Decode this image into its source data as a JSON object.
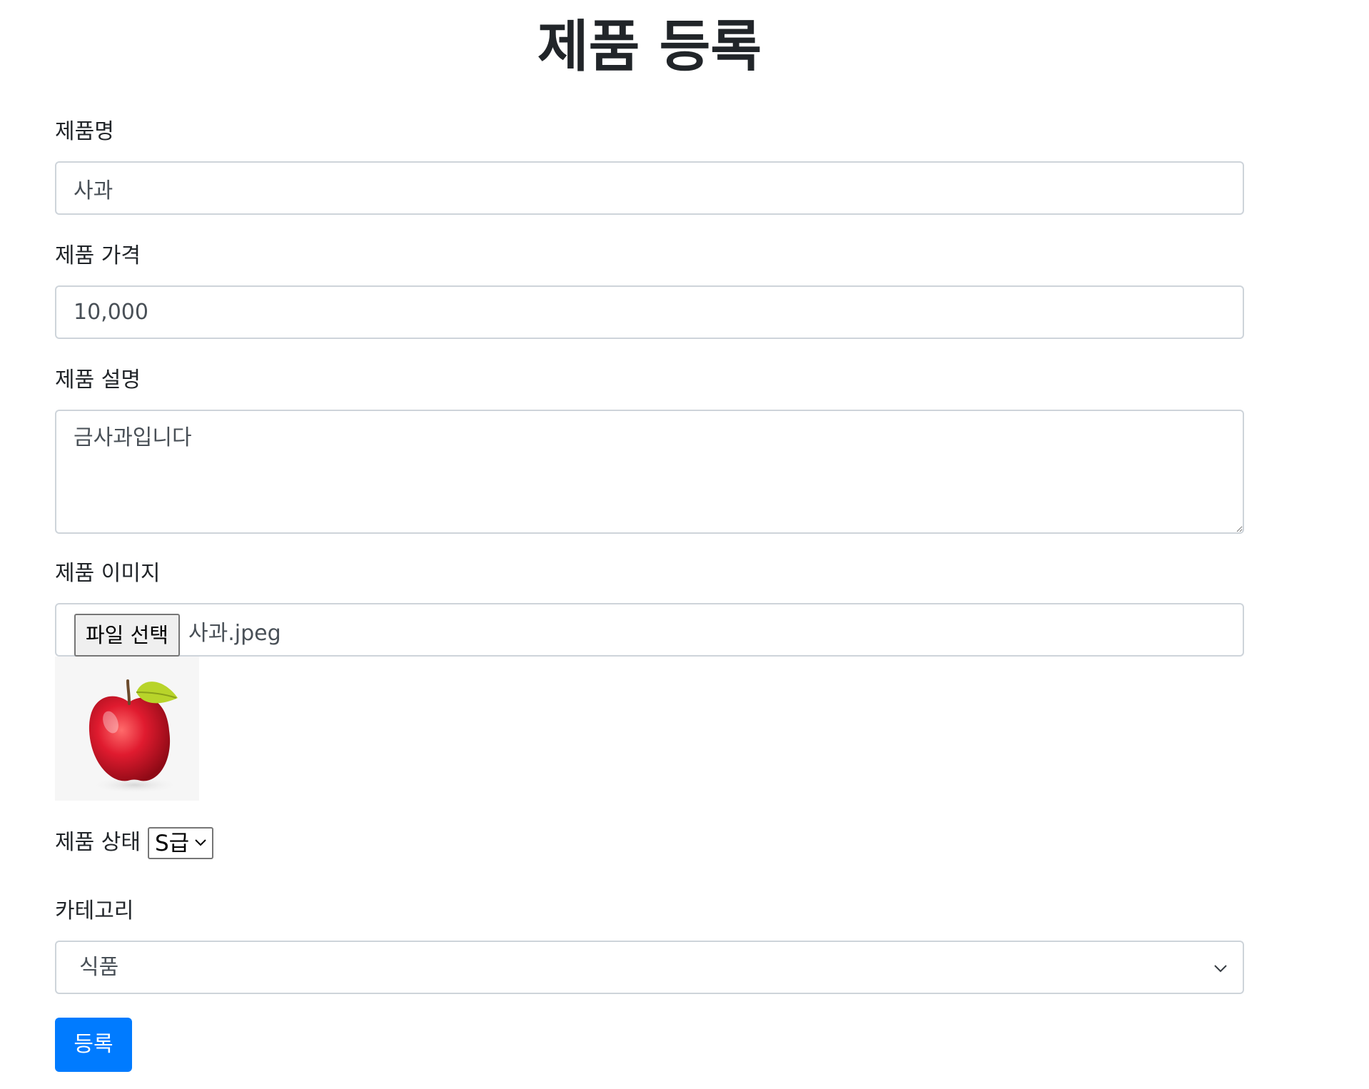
{
  "page": {
    "title": "제품 등록"
  },
  "form": {
    "name": {
      "label": "제품명",
      "value": "사과"
    },
    "price": {
      "label": "제품 가격",
      "value": "10,000"
    },
    "description": {
      "label": "제품 설명",
      "value": "금사과입니다"
    },
    "image": {
      "label": "제품 이미지",
      "button_label": "파일 선택",
      "file_name": "사과.jpeg",
      "preview_icon": "apple-photo"
    },
    "status": {
      "label": "제품 상태",
      "selected": "S급"
    },
    "category": {
      "label": "카테고리",
      "selected": "식품"
    },
    "submit_label": "등록"
  },
  "colors": {
    "primary": "#007bff",
    "text": "#212529",
    "input_text": "#495057",
    "input_border": "#ced4da"
  }
}
